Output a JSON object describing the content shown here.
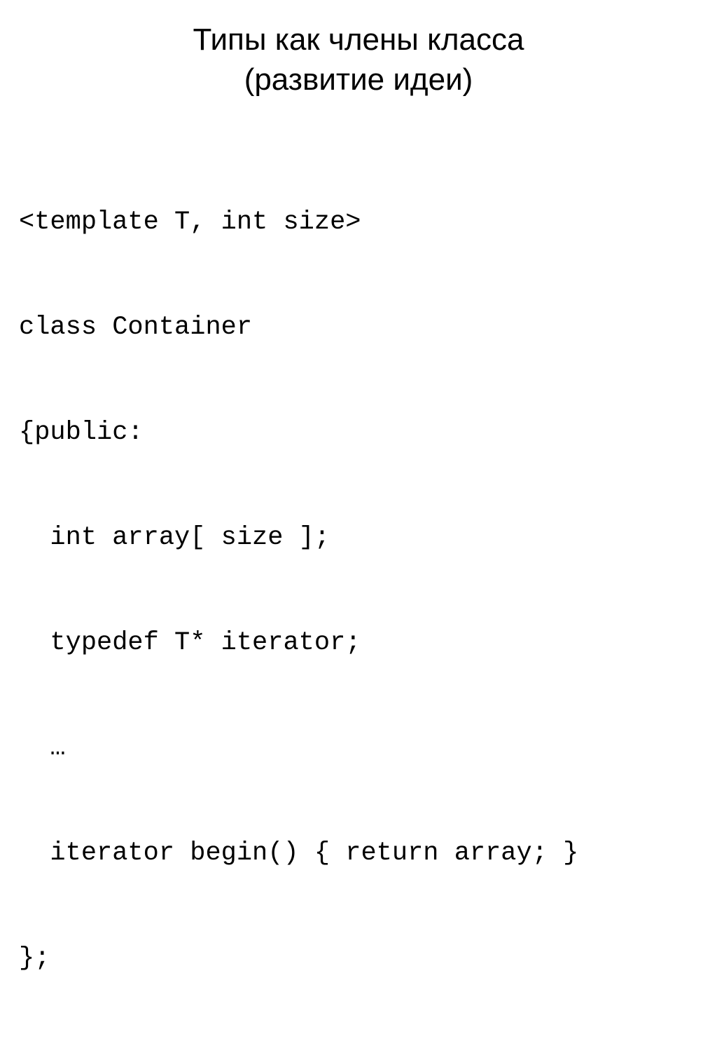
{
  "slide": {
    "background_color": "#ffffff",
    "text_color": "#000000",
    "title": {
      "line1": "Типы как члены класса",
      "line2": "(развитие идеи)"
    },
    "code": {
      "language": "cpp",
      "lines": [
        "<template T, int size>",
        "class Container",
        "{public:",
        "  int array[ size ];",
        "  typedef T* iterator;",
        "  …",
        "  iterator begin() { return array; }",
        "};"
      ]
    }
  }
}
